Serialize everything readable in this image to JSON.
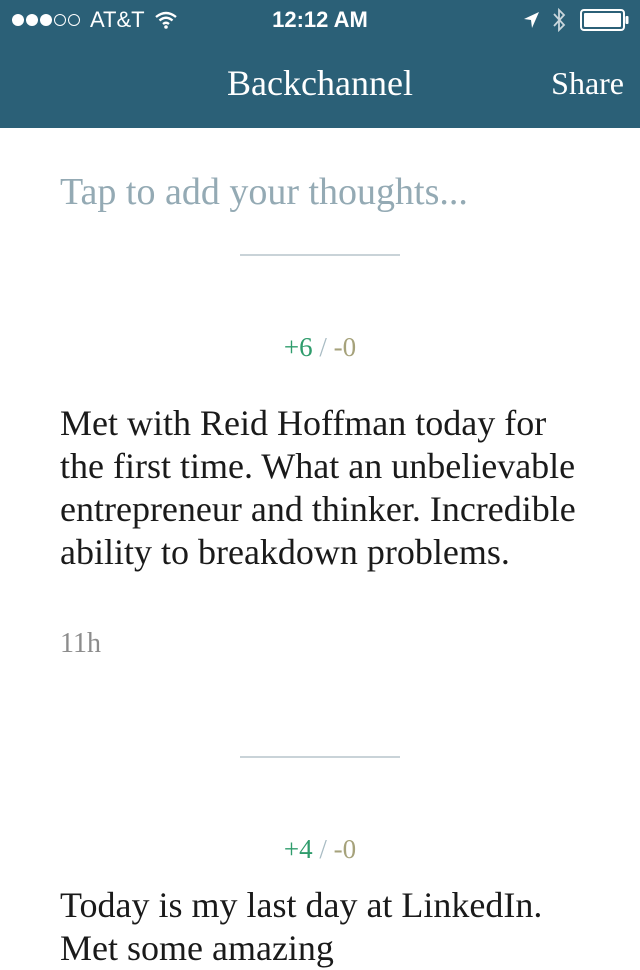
{
  "status_bar": {
    "signal_filled": 3,
    "signal_total": 5,
    "carrier": "AT&T",
    "time": "12:12 AM",
    "icons": [
      "wifi-icon",
      "location-icon",
      "bluetooth-icon",
      "battery-icon"
    ]
  },
  "nav": {
    "title": "Backchannel",
    "share_label": "Share",
    "background_color": "#2b6077"
  },
  "compose": {
    "placeholder": "Tap to add your thoughts..."
  },
  "posts": [
    {
      "upvotes": "+6",
      "separator": "/",
      "downvotes": "-0",
      "text": "Met with Reid Hoffman today for the first time. What an unbelievable entrepreneur and thinker. Incredible ability to breakdown problems.",
      "time": "11h"
    },
    {
      "upvotes": "+4",
      "separator": "/",
      "downvotes": "-0",
      "text": "Today is my last day at LinkedIn. Met some amazing"
    }
  ],
  "colors": {
    "upvote": "#2f9c6c",
    "downvote": "#a6a27b",
    "placeholder": "#94aab4"
  }
}
